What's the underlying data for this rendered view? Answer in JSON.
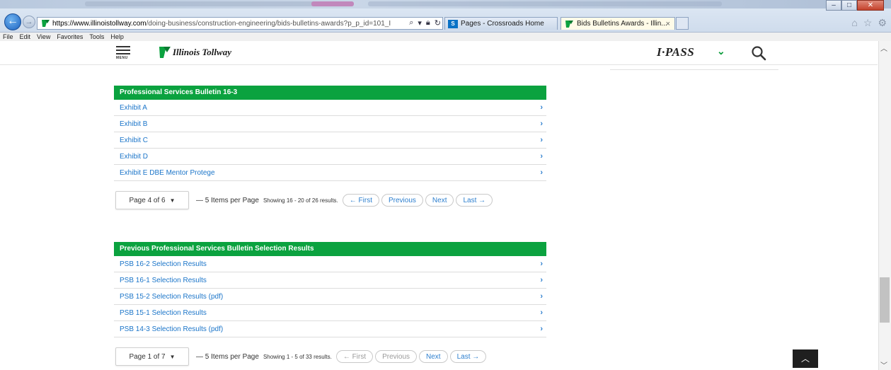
{
  "browser": {
    "url_domain": "https://www.illinoistollway.com",
    "url_path": "/doing-business/construction-engineering/bids-bulletins-awards?p_p_id=101_I",
    "tabs": [
      {
        "label": "Pages - Crossroads Home"
      },
      {
        "label": "Bids Bulletins Awards - Illin..."
      }
    ],
    "tab_close_glyph": "×",
    "menu": [
      "File",
      "Edit",
      "View",
      "Favorites",
      "Tools",
      "Help"
    ]
  },
  "header": {
    "menu_label": "MENU",
    "logo_text": "Illinois Tollway",
    "ipass_label": "I·PASS",
    "brand_green": "#0ba23f"
  },
  "bulletin": {
    "title": "Professional Services Bulletin 16-3",
    "items": [
      {
        "label": "Exhibit A"
      },
      {
        "label": "Exhibit B"
      },
      {
        "label": "Exhibit C"
      },
      {
        "label": "Exhibit D"
      },
      {
        "label": "Exhibit E DBE Mentor Protege"
      }
    ],
    "pager": {
      "page_label": "Page 4 of 6",
      "per_page": "— 5 Items per Page",
      "showing": "Showing 16 - 20 of 26 results.",
      "first": "← First",
      "previous": "Previous",
      "next": "Next",
      "last": "Last →"
    }
  },
  "results": {
    "title": "Previous Professional Services Bulletin Selection Results",
    "items": [
      {
        "label": "PSB 16-2 Selection Results"
      },
      {
        "label": "PSB 16-1 Selection Results"
      },
      {
        "label": "PSB 15-2 Selection Results (pdf)"
      },
      {
        "label": "PSB 15-1 Selection Results"
      },
      {
        "label": "PSB 14-3 Selection Results (pdf)"
      }
    ],
    "pager": {
      "page_label": "Page 1 of 7",
      "per_page": "— 5 Items per Page",
      "showing": "Showing 1 - 5 of 33 results.",
      "first": "← First",
      "previous": "Previous",
      "next": "Next",
      "last": "Last →"
    }
  },
  "icons": {
    "row_chevron": "›",
    "caret": "▼",
    "back_to_top": "︿"
  }
}
